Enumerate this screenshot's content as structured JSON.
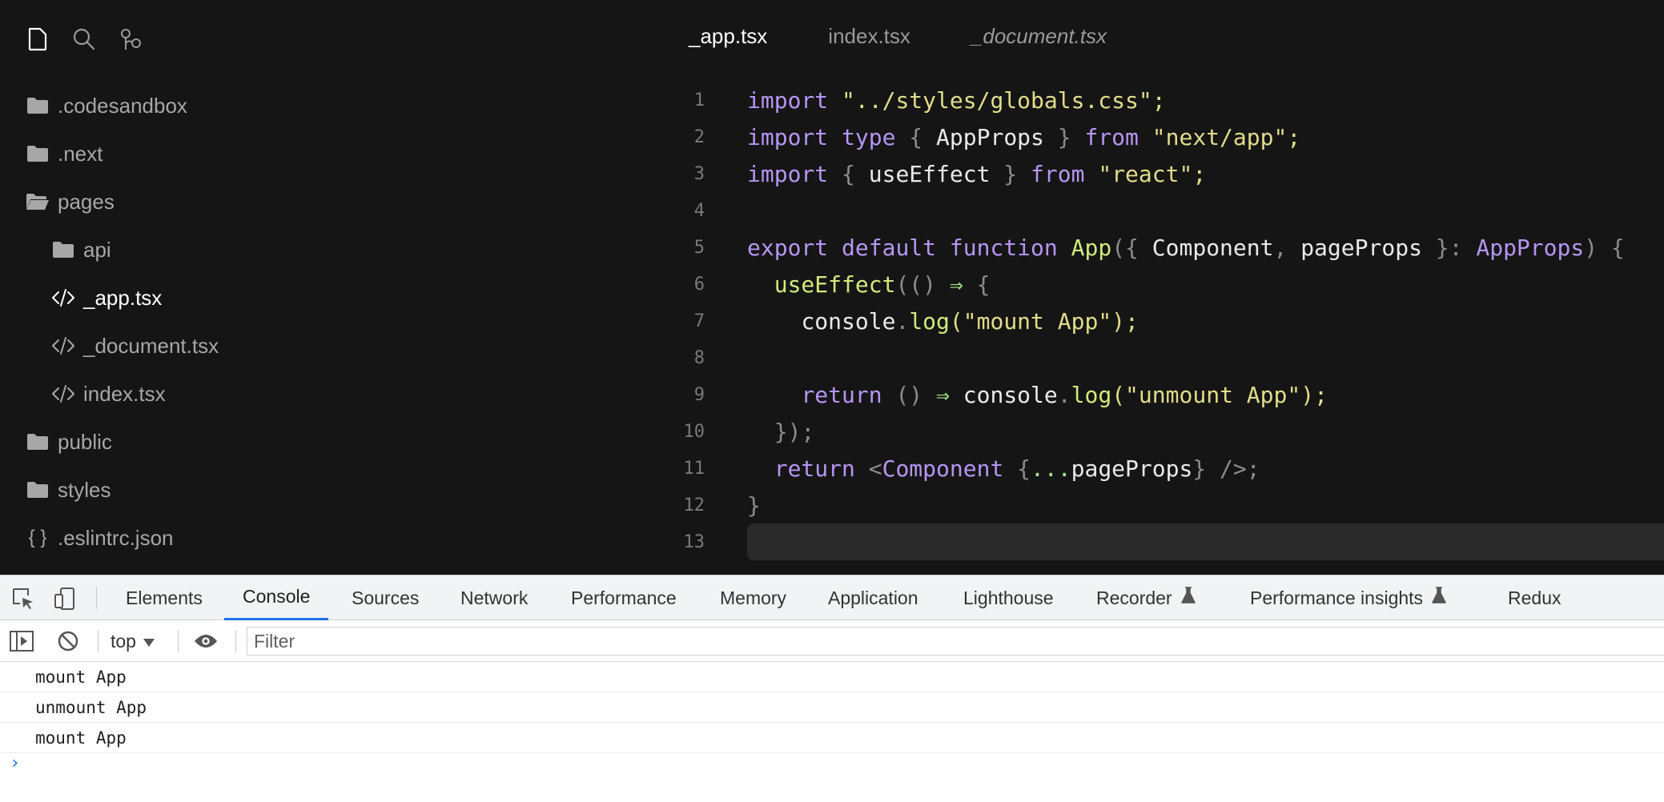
{
  "editor": {
    "sidebar_icons": [
      "file-icon",
      "search-icon",
      "source-control-icon"
    ],
    "file_tree": [
      {
        "label": ".codesandbox",
        "icon": "folder-icon",
        "depth": 0
      },
      {
        "label": ".next",
        "icon": "folder-icon",
        "depth": 0
      },
      {
        "label": "pages",
        "icon": "folder-open-icon",
        "depth": 0
      },
      {
        "label": "api",
        "icon": "folder-icon",
        "depth": 1
      },
      {
        "label": "_app.tsx",
        "icon": "code-file-icon",
        "depth": 1,
        "active": true
      },
      {
        "label": "_document.tsx",
        "icon": "code-file-icon",
        "depth": 1
      },
      {
        "label": "index.tsx",
        "icon": "code-file-icon",
        "depth": 1
      },
      {
        "label": "public",
        "icon": "folder-icon",
        "depth": 0
      },
      {
        "label": "styles",
        "icon": "folder-icon",
        "depth": 0
      },
      {
        "label": ".eslintrc.json",
        "icon": "json-file-icon",
        "depth": 0
      }
    ],
    "json_icon_glyph": "{ }",
    "tabs": [
      {
        "label": "_app.tsx",
        "active": true
      },
      {
        "label": "index.tsx"
      },
      {
        "label": "_document.tsx",
        "italic": true
      }
    ],
    "line_numbers": [
      "1",
      "2",
      "3",
      "4",
      "5",
      "6",
      "7",
      "8",
      "9",
      "10",
      "11",
      "12",
      "13"
    ],
    "code_tokens": {
      "l1": [
        "import",
        " \"",
        "../styles/globals.css",
        "\";"
      ],
      "l2": [
        "import",
        " ",
        "type",
        " { ",
        "AppProps",
        " } ",
        "from",
        " \"",
        "next/app",
        "\";"
      ],
      "l3": [
        "import",
        " { ",
        "useEffect",
        " } ",
        "from",
        " \"",
        "react",
        "\";"
      ],
      "l5": [
        "export",
        " ",
        "default",
        " ",
        "function",
        " ",
        "App",
        "({ ",
        "Component",
        ", ",
        "pageProps",
        " }: ",
        "AppProps",
        ") {"
      ],
      "l6": [
        "  ",
        "useEffect",
        "(() ",
        "⇒",
        " {"
      ],
      "l7": [
        "    ",
        "console",
        ".",
        "log",
        "(\"",
        "mount App",
        "\");"
      ],
      "l9": [
        "    ",
        "return",
        " () ",
        "⇒",
        " ",
        "console",
        ".",
        "log",
        "(\"",
        "unmount App",
        "\");"
      ],
      "l10": [
        "  ",
        "});"
      ],
      "l11": [
        "  ",
        "return",
        " <",
        "Component",
        " {",
        "...",
        "pageProps",
        "} />;"
      ],
      "l12": [
        "}"
      ]
    }
  },
  "devtools": {
    "tabs": [
      {
        "label": "Elements"
      },
      {
        "label": "Console",
        "active": true
      },
      {
        "label": "Sources"
      },
      {
        "label": "Network"
      },
      {
        "label": "Performance"
      },
      {
        "label": "Memory"
      },
      {
        "label": "Application"
      },
      {
        "label": "Lighthouse"
      },
      {
        "label": "Recorder",
        "flask": true
      },
      {
        "label": "Performance insights",
        "flask": true
      },
      {
        "label": "Redux"
      }
    ],
    "context": "top",
    "filter_placeholder": "Filter",
    "messages": [
      "mount App",
      "unmount App",
      "mount App"
    ],
    "prompt": "›"
  }
}
